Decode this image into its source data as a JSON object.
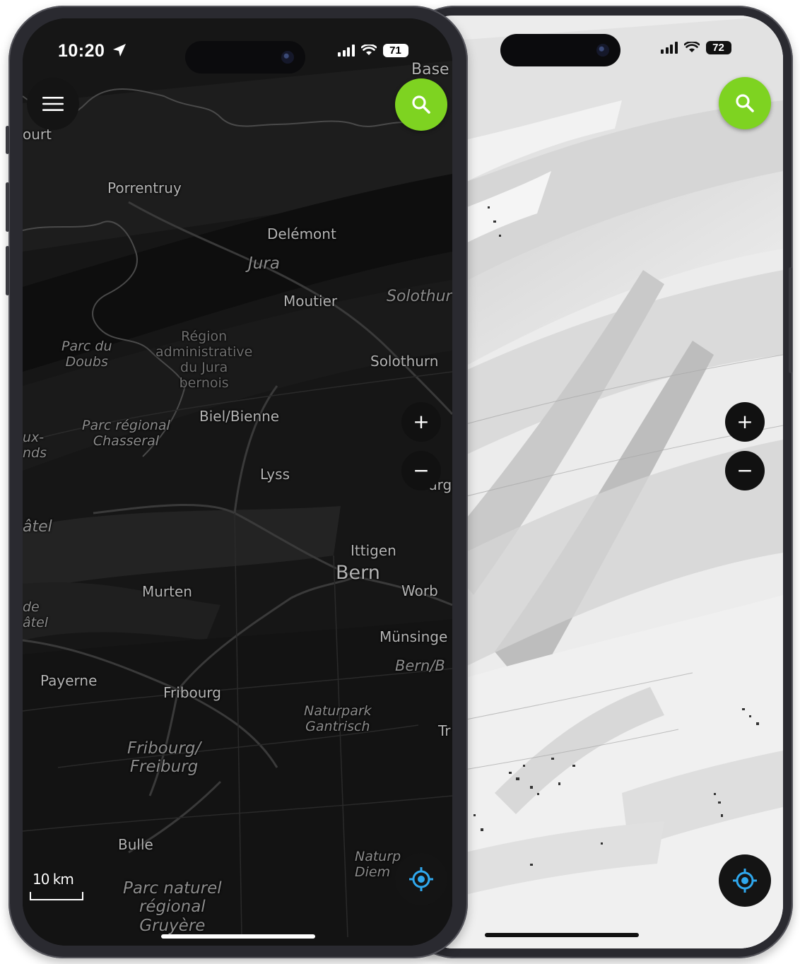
{
  "colors": {
    "accent_green": "#7ed321",
    "locate_blue": "#2fa8ee",
    "dark_map_bg": "#151515",
    "light_map_bg": "#e9e9e9"
  },
  "dark_phone": {
    "status": {
      "time": "10:20",
      "battery": "71",
      "location_icon": "location-arrow-icon"
    },
    "buttons": {
      "menu_icon": "hamburger-menu-icon",
      "search_icon": "search-icon",
      "zoom_in": "+",
      "zoom_out": "−",
      "locate_icon": "crosshair-locate-icon"
    },
    "scale": {
      "label": "10 km"
    },
    "map_labels": {
      "towns": [
        {
          "text": "Porrentruy"
        },
        {
          "text": "Delémont"
        },
        {
          "text": "Moutier"
        },
        {
          "text": "Solothurn"
        },
        {
          "text": "Biel/Bienne"
        },
        {
          "text": "Lyss"
        },
        {
          "text": "Ittigen"
        },
        {
          "text": "Bern"
        },
        {
          "text": "Worb"
        },
        {
          "text": "Murten"
        },
        {
          "text": "Münsinge"
        },
        {
          "text": "Payerne"
        },
        {
          "text": "Fribourg"
        },
        {
          "text": "Bulle"
        },
        {
          "text": "Base"
        },
        {
          "text": "ourt"
        },
        {
          "text": "urg"
        },
        {
          "text": "Tr"
        }
      ],
      "areas": [
        {
          "text": "Jura"
        },
        {
          "text": "Solothur"
        },
        {
          "text": "Région\nadministrative\ndu Jura\nbernois"
        },
        {
          "text": "Parc du\nDoubs"
        },
        {
          "text": "Parc régional\nChasseral"
        },
        {
          "text": "ux-\nnds"
        },
        {
          "text": "âtel"
        },
        {
          "text": "de\nâtel"
        },
        {
          "text": "Bern/B"
        },
        {
          "text": "Naturpark\nGantrisch"
        },
        {
          "text": "Fribourg/\nFreiburg"
        },
        {
          "text": "Naturp\nDiem"
        },
        {
          "text": "Parc naturel\nrégional\nGruyère"
        }
      ]
    }
  },
  "light_phone": {
    "status": {
      "battery": "72"
    },
    "buttons": {
      "search_icon": "search-icon",
      "zoom_in": "+",
      "zoom_out": "−",
      "locate_icon": "crosshair-locate-icon"
    }
  }
}
